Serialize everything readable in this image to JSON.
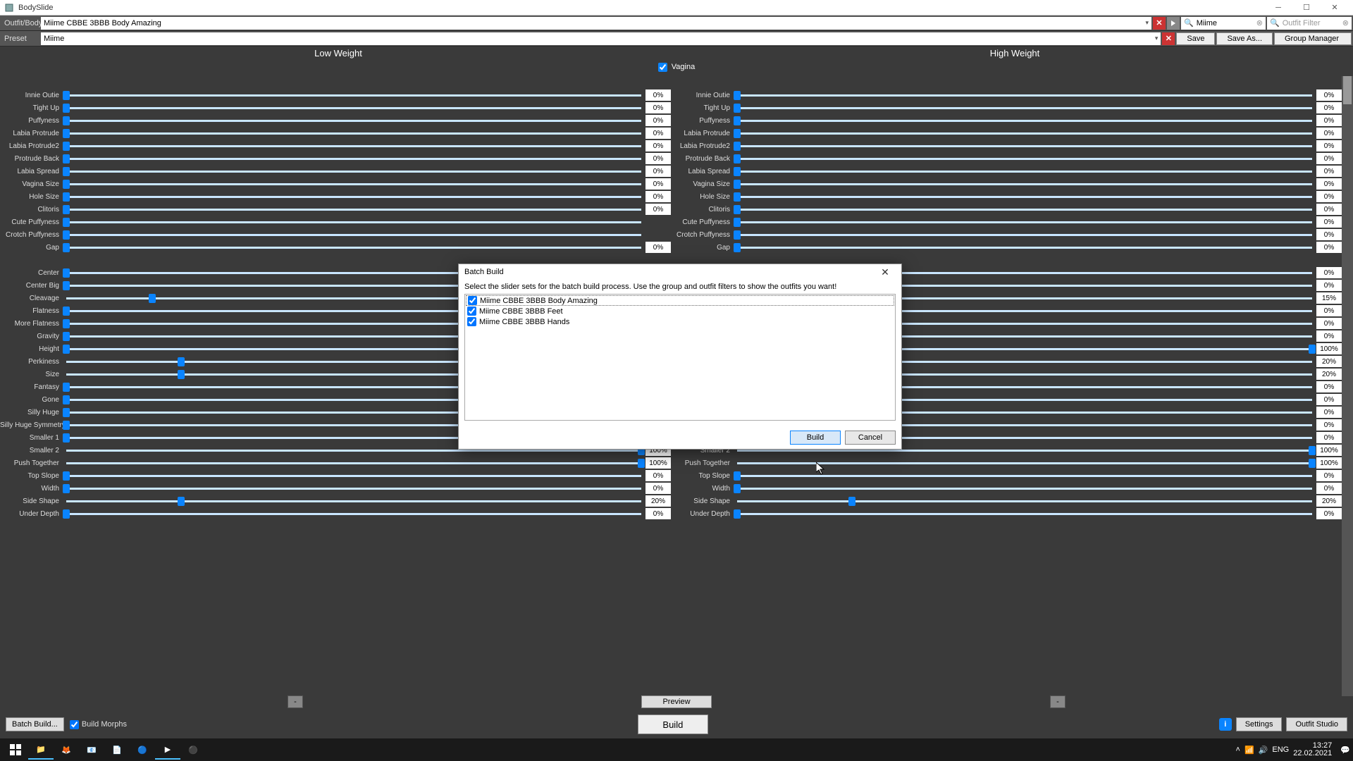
{
  "title": "BodySlide",
  "toolbar": {
    "outfit_label": "Outfit/Body",
    "outfit_value": "Miime CBBE 3BBB Body Amazing",
    "preset_label": "Preset",
    "preset_value": "Miime",
    "search1_value": "Miime",
    "outfit_filter_placeholder": "Outfit Filter",
    "save_label": "Save",
    "saveas_label": "Save As...",
    "groupmgr_label": "Group Manager"
  },
  "headers": {
    "low": "Low Weight",
    "high": "High Weight"
  },
  "section": {
    "name": "Vagina",
    "checked": true
  },
  "sliders": [
    {
      "name": "Innie Outie",
      "low": 0,
      "high": 0
    },
    {
      "name": "Tight Up",
      "low": 0,
      "high": 0
    },
    {
      "name": "Puffyness",
      "low": 0,
      "high": 0
    },
    {
      "name": "Labia Protrude",
      "low": 0,
      "high": 0
    },
    {
      "name": "Labia Protrude2",
      "low": 0,
      "high": 0
    },
    {
      "name": "Protrude Back",
      "low": 0,
      "high": 0
    },
    {
      "name": "Labia Spread",
      "low": 0,
      "high": 0
    },
    {
      "name": "Vagina Size",
      "low": 0,
      "high": 0
    },
    {
      "name": "Hole Size",
      "low": 0,
      "high": 0
    },
    {
      "name": "Clitoris",
      "low": 0,
      "high": 0
    },
    {
      "name": "Cute Puffyness",
      "low": null,
      "high": 0
    },
    {
      "name": "Crotch Puffyness",
      "low": null,
      "high": 0
    },
    {
      "name": "Gap",
      "low": 0,
      "high": 0
    },
    {
      "gap": true
    },
    {
      "name": "Center",
      "low": null,
      "high": 0
    },
    {
      "name": "Center Big",
      "low": null,
      "high": 0
    },
    {
      "name": "Cleavage",
      "low": 15,
      "high": 15
    },
    {
      "name": "Flatness",
      "low": null,
      "high": 0
    },
    {
      "name": "More Flatness",
      "low": null,
      "high": 0
    },
    {
      "name": "Gravity",
      "low": null,
      "high": 0
    },
    {
      "name": "Height",
      "low": null,
      "high": 100
    },
    {
      "name": "Perkiness",
      "low": 20,
      "high": 20
    },
    {
      "name": "Size",
      "low": 20,
      "high": 20
    },
    {
      "name": "Fantasy",
      "low": 0,
      "high": 0
    },
    {
      "name": "Gone",
      "low": 0,
      "high": 0
    },
    {
      "name": "Silly Huge",
      "low": 0,
      "high": 0
    },
    {
      "name": "Silly Huge Symmetry",
      "low": 0,
      "high": 0
    },
    {
      "name": "Smaller 1",
      "low": 0,
      "high": 0
    },
    {
      "name": "Smaller 2",
      "low": 100,
      "high": 100
    },
    {
      "name": "Push Together",
      "low": 100,
      "high": 100
    },
    {
      "name": "Top Slope",
      "low": 0,
      "high": 0
    },
    {
      "name": "Width",
      "low": 0,
      "high": 0
    },
    {
      "name": "Side Shape",
      "low": 20,
      "high": 20
    },
    {
      "name": "Under Depth",
      "low": 0,
      "high": 0
    }
  ],
  "footer": {
    "minus": "-",
    "preview": "Preview",
    "batch_build": "Batch Build...",
    "build_morphs": "Build Morphs",
    "build": "Build",
    "settings": "Settings",
    "outfit_studio": "Outfit Studio"
  },
  "modal": {
    "title": "Batch Build",
    "instruction": "Select the slider sets for the batch build process. Use the group and outfit filters to show the outfits you want!",
    "items": [
      {
        "label": "Miime CBBE 3BBB Body Amazing",
        "checked": true,
        "selected": true
      },
      {
        "label": "Miime CBBE 3BBB Feet",
        "checked": true
      },
      {
        "label": "Miime CBBE 3BBB Hands",
        "checked": true
      }
    ],
    "build": "Build",
    "cancel": "Cancel"
  },
  "taskbar": {
    "time": "13:27",
    "date": "22.02.2021"
  }
}
